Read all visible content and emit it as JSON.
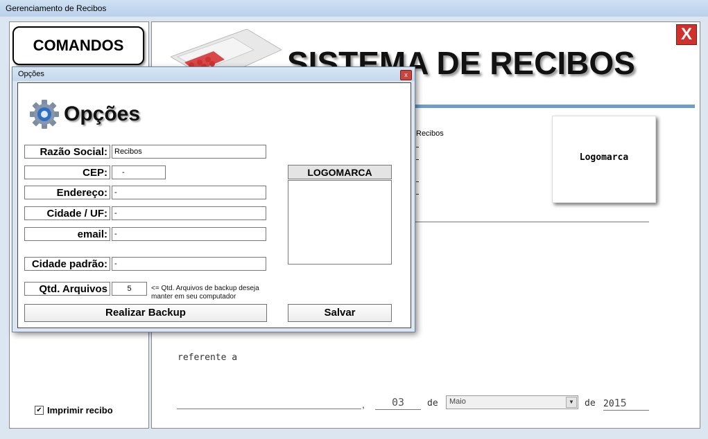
{
  "window": {
    "title": "Gerenciamento de Recibos"
  },
  "left": {
    "commands_label": "COMANDOS",
    "print_receipt": {
      "label": "Imprimir recibo",
      "checked": true,
      "mark": "✔"
    }
  },
  "main": {
    "close_glyph": "X",
    "system_title": "SISTEMA DE RECIBOS",
    "logo_placeholder": "Logomarca",
    "behind_company": "Recibos",
    "referente_label": "referente a",
    "comma": ",",
    "date": {
      "day": "03",
      "de1": "de",
      "month": "Maio",
      "de2": "de",
      "year_prefix": "20",
      "year_suffix": "15"
    }
  },
  "dialog": {
    "title": "Opções",
    "close_glyph": "x",
    "heading": "Opções",
    "fields": {
      "razao_social": {
        "label": "Razão Social:",
        "value": "Recibos"
      },
      "cep": {
        "label": "CEP:",
        "value": "-"
      },
      "endereco": {
        "label": "Endereço:",
        "value": "-"
      },
      "cidade_uf": {
        "label": "Cidade / UF:",
        "value": "-"
      },
      "email": {
        "label": "email:",
        "value": "-"
      },
      "cidade_padrao": {
        "label": "Cidade padrão:",
        "value": "-"
      },
      "qtd_arquivos": {
        "label": "Qtd. Arquivos",
        "value": "5",
        "hint": "<= Qtd. Arquivos de backup deseja manter em seu computador"
      }
    },
    "logomarca_label": "LOGOMARCA",
    "backup_button": "Realizar Backup",
    "save_button": "Salvar"
  }
}
